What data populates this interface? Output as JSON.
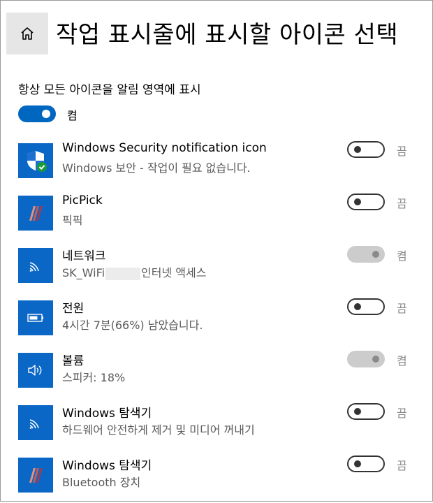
{
  "header": {
    "title": "작업 표시줄에 표시할 아이콘 선택",
    "home_icon": "home-icon"
  },
  "master": {
    "label": "항상 모든 아이콘을 알림 영역에 표시",
    "state_label": "켬",
    "on": true,
    "accent_color": "#0067c0"
  },
  "items": [
    {
      "name": "Windows Security notification icon",
      "sub": "Windows 보안 - 작업이 필요 없습니다.",
      "icon": "shield-check-icon",
      "on": false,
      "enabled": true,
      "state_label": "끔"
    },
    {
      "name": "PicPick",
      "sub": "픽픽",
      "icon": "picpick-icon",
      "on": false,
      "enabled": true,
      "state_label": "끔"
    },
    {
      "name": "네트워크",
      "sub_prefix": "SK_WiFi",
      "sub_suffix": "인터넷 액세스",
      "icon": "wifi-icon",
      "on": true,
      "enabled": false,
      "state_label": "켬"
    },
    {
      "name": "전원",
      "sub": "4시간 7분(66%) 남았습니다.",
      "icon": "battery-icon",
      "on": false,
      "enabled": true,
      "state_label": "끔"
    },
    {
      "name": "볼륨",
      "sub": "스피커: 18%",
      "icon": "speaker-icon",
      "on": true,
      "enabled": false,
      "state_label": "켬"
    },
    {
      "name": "Windows 탐색기",
      "sub": "하드웨어 안전하게 제거 및 미디어 꺼내기",
      "icon": "usb-eject-icon",
      "on": false,
      "enabled": true,
      "state_label": "끔"
    },
    {
      "name": "Windows 탐색기",
      "sub": "Bluetooth 장치",
      "icon": "picpick-icon",
      "on": false,
      "enabled": true,
      "state_label": "끔"
    }
  ],
  "colors": {
    "tile_blue": "#0a67c6",
    "toggle_off_border": "#333333",
    "toggle_disabled": "#cccccc",
    "subtext": "#5a5a5a"
  }
}
